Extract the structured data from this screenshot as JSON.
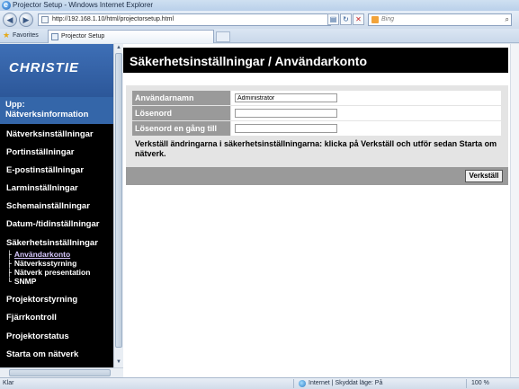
{
  "window": {
    "title": "Projector Setup - Windows Internet Explorer"
  },
  "toolbar": {
    "back_icon": "back-arrow-icon",
    "forward_icon": "forward-arrow-icon",
    "address": "http://192.168.1.10/html/projectorsetup.html",
    "search_placeholder": "Bing"
  },
  "favorites": {
    "label": "Favorites",
    "tab_label": "Projector Setup"
  },
  "sidebar": {
    "logo": "CHRISTIE",
    "up_label": "Upp: Nätverksinformation",
    "items": [
      {
        "label": "Nätverksinställningar"
      },
      {
        "label": "Portinställningar"
      },
      {
        "label": "E-postinställningar"
      },
      {
        "label": "Larminställningar"
      },
      {
        "label": "Schemainställningar"
      },
      {
        "label": "Datum-/tidinställningar"
      },
      {
        "label": "Säkerhetsinställningar"
      }
    ],
    "subitems": [
      {
        "tree": "├",
        "label": "Användarkonto",
        "active": true
      },
      {
        "tree": "├",
        "label": "Nätverksstyrning"
      },
      {
        "tree": "├",
        "label": "Nätverk presentation"
      },
      {
        "tree": "└",
        "label": "SNMP"
      }
    ],
    "items_after": [
      {
        "label": "Projektorstyrning"
      },
      {
        "label": "Fjärrkontroll"
      },
      {
        "label": "Projektorstatus"
      },
      {
        "label": "Starta om nätverk"
      }
    ]
  },
  "main": {
    "title": "Säkerhetsinställningar / Användarkonto",
    "fields": [
      {
        "label": "Användarnamn",
        "value": "Administrator"
      },
      {
        "label": "Lösenord",
        "value": ""
      },
      {
        "label": "Lösenord en gång till",
        "value": ""
      }
    ],
    "note": "Verkställ ändringarna i säkerhetsinställningarna: klicka på Verkställ och utför sedan Starta om nätverk.",
    "apply_label": "Verkställ"
  },
  "statusbar": {
    "left": "Klar",
    "zone": "Internet | Skyddat läge: På",
    "zoom": "100 %"
  }
}
